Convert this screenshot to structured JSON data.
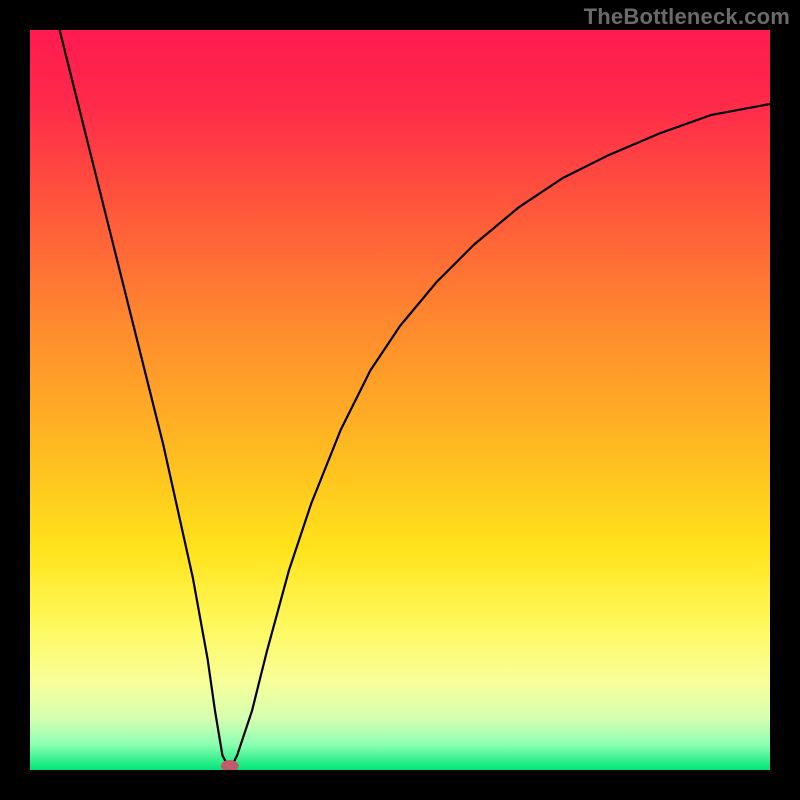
{
  "watermark": "TheBottleneck.com",
  "chart_data": {
    "type": "line",
    "title": "",
    "xlabel": "",
    "ylabel": "",
    "xlim": [
      0,
      100
    ],
    "ylim": [
      0,
      100
    ],
    "grid": false,
    "legend": null,
    "series": [
      {
        "name": "bottleneck-curve",
        "x": [
          4,
          6,
          8,
          10,
          12,
          14,
          16,
          18,
          20,
          22,
          24,
          25,
          26,
          27,
          28,
          30,
          32,
          35,
          38,
          42,
          46,
          50,
          55,
          60,
          66,
          72,
          78,
          85,
          92,
          100
        ],
        "values": [
          100,
          92,
          84,
          76,
          68,
          60,
          52,
          44,
          35,
          26,
          15,
          8,
          2,
          0,
          2,
          8,
          16,
          27,
          36,
          46,
          54,
          60,
          66,
          71,
          76,
          80,
          83,
          86,
          88.5,
          90
        ]
      }
    ],
    "marker": {
      "x": 27,
      "y": 0
    },
    "gradient_stops": [
      {
        "pos": 0.0,
        "color": "#ff1a4f"
      },
      {
        "pos": 0.1,
        "color": "#ff2a4a"
      },
      {
        "pos": 0.25,
        "color": "#ff5a3a"
      },
      {
        "pos": 0.4,
        "color": "#ff8a2e"
      },
      {
        "pos": 0.55,
        "color": "#ffb522"
      },
      {
        "pos": 0.7,
        "color": "#ffe31a"
      },
      {
        "pos": 0.8,
        "color": "#fff85a"
      },
      {
        "pos": 0.88,
        "color": "#f8ff9a"
      },
      {
        "pos": 0.93,
        "color": "#d6ffb0"
      },
      {
        "pos": 0.965,
        "color": "#8dffb3"
      },
      {
        "pos": 1.0,
        "color": "#00e676"
      }
    ]
  }
}
